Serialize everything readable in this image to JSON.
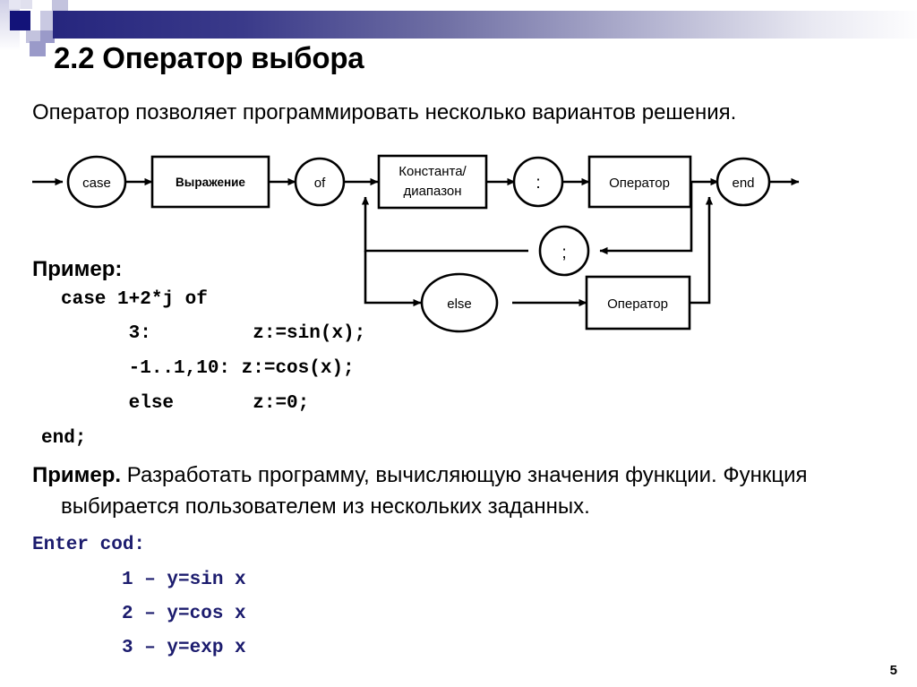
{
  "slide": {
    "title": "2.2 Оператор выбора",
    "lead": "Оператор позволяет программировать несколько вариантов решения.",
    "page_number": "5",
    "accent_dark": "#26267e",
    "accent_light": "#b6b6d2",
    "code_blue": "#1c1c6e"
  },
  "diagram": {
    "nodes": {
      "case": "case",
      "expression": "Выражение",
      "of": "of",
      "constant_line1": "Константа/",
      "constant_line2": "диапазон",
      "colon": ":",
      "operator1": "Оператор",
      "end": "end",
      "semicolon": ";",
      "else": "else",
      "operator2": "Оператор"
    }
  },
  "example1": {
    "label": "Пример:",
    "lines": [
      "case 1+2*j of",
      "      3:         z:=sin(x);",
      "      -1..1,10: z:=cos(x);",
      "      else       z:=0;",
      "end;"
    ]
  },
  "example2": {
    "label": "Пример.",
    "text_line1": "Разработать программу, вычисляющую значения функции. Функция",
    "text_line2": "выбирается пользователем из нескольких заданных."
  },
  "enter_block": {
    "prompt": "Enter cod:",
    "options": [
      "1 – y=sin x",
      "2 – y=cos x",
      "3 – y=exp x"
    ]
  }
}
